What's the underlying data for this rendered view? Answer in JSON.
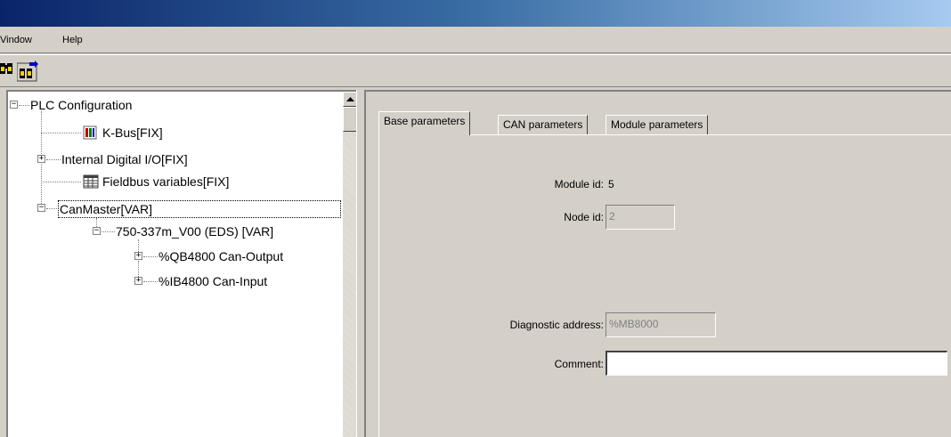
{
  "menu": {
    "window": "Vindow",
    "help": "Help"
  },
  "toolbar": {
    "buttons": [
      "find-icon",
      "find-next-icon"
    ]
  },
  "tree": {
    "root": "PLC Configuration",
    "kbus": "K-Bus[FIX]",
    "internal_io": "Internal Digital I/O[FIX]",
    "fieldbus": "Fieldbus variables[FIX]",
    "canmaster": "CanMaster[VAR]",
    "module": "750-337m_V00 (EDS)  [VAR]",
    "output": "%QB4800 Can-Output",
    "input": "%IB4800 Can-Input"
  },
  "tabs": [
    "Base parameters",
    "CAN parameters",
    "Module parameters"
  ],
  "form": {
    "module_id_label": "Module id:",
    "module_id_value": "5",
    "node_id_label": "Node id:",
    "node_id_value": "2",
    "diag_label": "Diagnostic address:",
    "diag_value": "%MB8000",
    "comment_label": "Comment:",
    "comment_value": ""
  }
}
